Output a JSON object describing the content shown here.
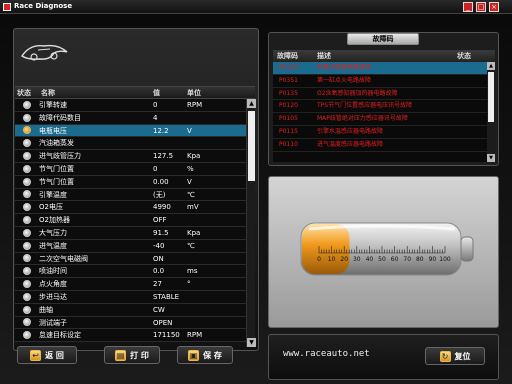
{
  "window": {
    "title": "Race Diagnose",
    "min_label": "_",
    "max_label": "□",
    "close_label": "×"
  },
  "data_grid": {
    "columns": {
      "status": "状态",
      "name": "名称",
      "value": "值",
      "unit": "单位"
    },
    "rows": [
      {
        "name": "引擎转速",
        "value": "0",
        "unit": "RPM"
      },
      {
        "name": "故障代码数目",
        "value": "4",
        "unit": ""
      },
      {
        "name": "电瓶电压",
        "value": "12.2",
        "unit": "V",
        "selected": true
      },
      {
        "name": "汽油箱蒸发",
        "value": "",
        "unit": ""
      },
      {
        "name": "进气歧管压力",
        "value": "127.5",
        "unit": "Kpa"
      },
      {
        "name": "节气门位置",
        "value": "0",
        "unit": "%"
      },
      {
        "name": "节气门位置",
        "value": "0.00",
        "unit": "V"
      },
      {
        "name": "引擎温度",
        "value": "(无)",
        "unit": "℃"
      },
      {
        "name": "O2电压",
        "value": "4990",
        "unit": "mV"
      },
      {
        "name": "O2加热器",
        "value": "OFF",
        "unit": ""
      },
      {
        "name": "大气压力",
        "value": "91.5",
        "unit": "Kpa"
      },
      {
        "name": "进气温度",
        "value": "-40",
        "unit": "℃"
      },
      {
        "name": "二次空气电磁阀",
        "value": "ON",
        "unit": ""
      },
      {
        "name": "喷油时间",
        "value": "0.0",
        "unit": "ms"
      },
      {
        "name": "点火角度",
        "value": "27",
        "unit": "°"
      },
      {
        "name": "步进马达",
        "value": "STABLE",
        "unit": ""
      },
      {
        "name": "曲轴",
        "value": "CW",
        "unit": ""
      },
      {
        "name": "测试端子",
        "value": "OPEN",
        "unit": ""
      },
      {
        "name": "怠速目标设定",
        "value": "171150",
        "unit": "RPM"
      }
    ]
  },
  "buttons": {
    "back": "返 回",
    "print": "打 印",
    "save": "保 存",
    "reset": "复位"
  },
  "fault_panel": {
    "title": "故障码",
    "columns": {
      "code": "故障码",
      "desc": "描述",
      "status": "状态"
    },
    "rows": [
      {
        "code": "P0130",
        "desc": "前氧传感器电路故障",
        "selected": true
      },
      {
        "code": "P0351",
        "desc": "第一缸点火电路故障"
      },
      {
        "code": "P0135",
        "desc": "O2含氧感知器加热器电路故障"
      },
      {
        "code": "P0120",
        "desc": "TPS节气门位置感应器电压讯号故障"
      },
      {
        "code": "P0105",
        "desc": "MAP歧管绝对压力感应器讯号故障"
      },
      {
        "code": "P0115",
        "desc": "引擎水温感应器电路故障"
      },
      {
        "code": "P0110",
        "desc": "进气温度感应器电路故障"
      }
    ]
  },
  "battery": {
    "level_fraction": 0.3,
    "scale_labels": [
      "0",
      "10",
      "20",
      "30",
      "40",
      "50",
      "60",
      "70",
      "80",
      "90",
      "100"
    ],
    "fill_color": "#e08a12",
    "empty_color": "#cfcfcf"
  },
  "website": "www.raceauto.net",
  "colors": {
    "selection": "#1b6b8e",
    "fault_text": "#e02020",
    "accent": "#d6921f"
  }
}
